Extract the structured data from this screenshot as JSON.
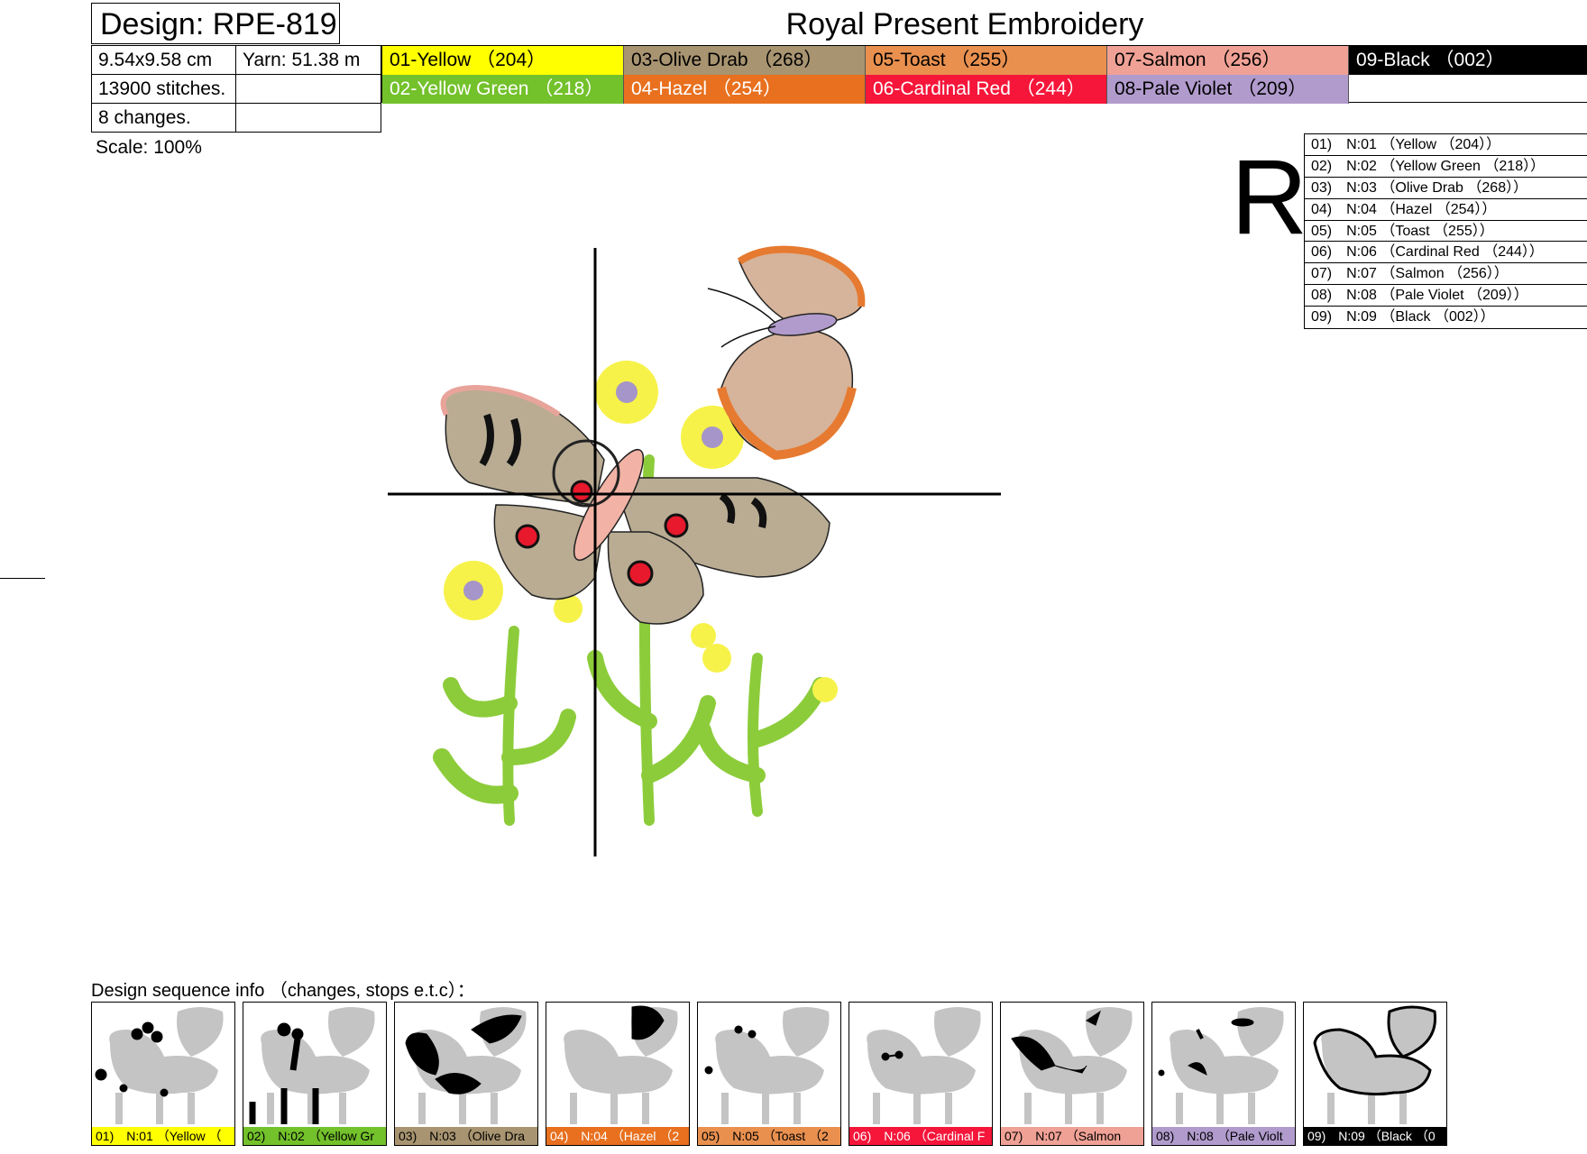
{
  "header": {
    "design_label": "Design: RPE-819",
    "company": "Royal Present Embroidery"
  },
  "info": {
    "size": "9.54x9.58 cm",
    "yarn": "Yarn: 51.38 m",
    "stitches": "13900 stitches.",
    "changes": "8 changes.",
    "scale": "Scale: 100%"
  },
  "colors": [
    {
      "label": "01-Yellow （204）",
      "hex": "#ffff00",
      "text": "#000000"
    },
    {
      "label": "02-Yellow Green （218）",
      "hex": "#73c12b",
      "text": "#ffffff"
    },
    {
      "label": "03-Olive Drab （268）",
      "hex": "#a89470",
      "text": "#000000"
    },
    {
      "label": "04-Hazel （254）",
      "hex": "#e8701e",
      "text": "#ffffff"
    },
    {
      "label": "05-Toast （255）",
      "hex": "#e9904f",
      "text": "#000000"
    },
    {
      "label": "06-Cardinal Red （244）",
      "hex": "#f5163a",
      "text": "#ffffff"
    },
    {
      "label": "07-Salmon （256）",
      "hex": "#f0a195",
      "text": "#000000"
    },
    {
      "label": "08-Pale Violet （209）",
      "hex": "#b19bcd",
      "text": "#000000"
    },
    {
      "label": "09-Black （002）",
      "hex": "#000000",
      "text": "#ffffff"
    }
  ],
  "reverse_mark": "R",
  "stitch_order": [
    "01)　N:01 （Yellow （204））",
    "02)　N:02 （Yellow Green （218））",
    "03)　N:03 （Olive Drab （268））",
    "04)　N:04 （Hazel （254））",
    "05)　N:05 （Toast （255））",
    "06)　N:06 （Cardinal Red （244））",
    "07)　N:07 （Salmon （256））",
    "08)　N:08 （Pale Violet （209））",
    "09)　N:09 （Black （002））"
  ],
  "sequence": {
    "label": "Design sequence info （changes, stops e.t.c）：",
    "thumbs": [
      {
        "label": "01)　N:01 （Yellow （",
        "hex": "#ffff00",
        "text": "#000000",
        "focus": "flowers"
      },
      {
        "label": "02)　N:02 （Yellow Gr",
        "hex": "#73c12b",
        "text": "#000000",
        "focus": "stems"
      },
      {
        "label": "03)　N:03 （Olive Dra",
        "hex": "#a89470",
        "text": "#000000",
        "focus": "wings"
      },
      {
        "label": "04)　N:04 （Hazel （2",
        "hex": "#e8701e",
        "text": "#ffffff",
        "focus": "small-wing"
      },
      {
        "label": "05)　N:05 （Toast （2",
        "hex": "#e9904f",
        "text": "#000000",
        "focus": "dots"
      },
      {
        "label": "06)　N:06 （Cardinal F",
        "hex": "#f5163a",
        "text": "#ffffff",
        "focus": "spots"
      },
      {
        "label": "07)　N:07 （Salmon",
        "hex": "#f0a195",
        "text": "#000000",
        "focus": "edges"
      },
      {
        "label": "08)　N:08 （Pale Violt",
        "hex": "#b19bcd",
        "text": "#000000",
        "focus": "bodies"
      },
      {
        "label": "09)　N:09 （Black （0",
        "hex": "#000000",
        "text": "#ffffff",
        "focus": "outline"
      }
    ]
  }
}
